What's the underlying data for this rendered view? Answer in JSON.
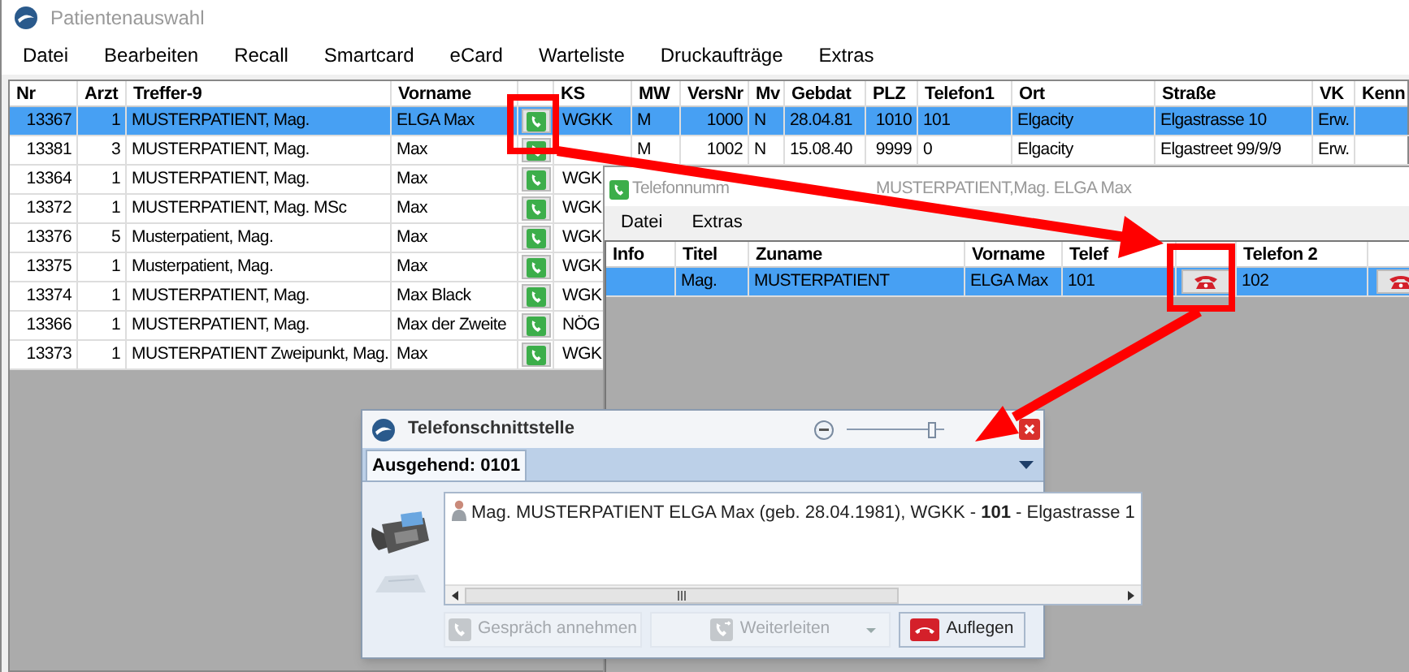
{
  "main_window": {
    "title": "Patientenauswahl",
    "menu": [
      "Datei",
      "Bearbeiten",
      "Recall",
      "Smartcard",
      "eCard",
      "Warteliste",
      "Druckaufträge",
      "Extras"
    ],
    "table": {
      "columns": [
        {
          "label": "Nr"
        },
        {
          "label": "Arzt"
        },
        {
          "label": "Treffer-9"
        },
        {
          "label": "Vorname"
        },
        {
          "kind": "greenphone"
        },
        {
          "label": "KS"
        },
        {
          "label": "MW"
        },
        {
          "label": "VersNr"
        },
        {
          "label": "Mv"
        },
        {
          "label": "Gebdat"
        },
        {
          "label": "PLZ"
        },
        {
          "label": "Telefon1"
        },
        {
          "label": "Ort"
        },
        {
          "label": "Straße"
        },
        {
          "label": "VK"
        },
        {
          "label": "Kenn"
        }
      ],
      "rows": [
        {
          "selected": true,
          "cells": [
            "13367",
            "1",
            "MUSTERPATIENT, Mag.",
            "ELGA Max",
            "",
            "WGKK",
            "M",
            "1000",
            "N",
            "28.04.81",
            "1010",
            "101",
            "Elgacity",
            "Elgastrasse 10",
            "Erw."
          ]
        },
        {
          "selected": false,
          "cells": [
            "13381",
            "3",
            "MUSTERPATIENT, Mag.",
            "Max",
            "",
            "",
            "M",
            "1002",
            "N",
            "15.08.40",
            "9999",
            "0",
            "Elgacity",
            "Elgastreet 99/9/9",
            "Erw."
          ]
        },
        {
          "selected": false,
          "cells": [
            "13364",
            "1",
            "MUSTERPATIENT, Mag.",
            "Max",
            "",
            "WGK"
          ]
        },
        {
          "selected": false,
          "cells": [
            "13372",
            "1",
            "MUSTERPATIENT, Mag. MSc",
            "Max",
            "",
            "WGK"
          ]
        },
        {
          "selected": false,
          "cells": [
            "13376",
            "5",
            "Musterpatient, Mag.",
            "Max",
            "",
            "WGK"
          ]
        },
        {
          "selected": false,
          "cells": [
            "13375",
            "1",
            "Musterpatient, Mag.",
            "Max",
            "",
            "WGK"
          ]
        },
        {
          "selected": false,
          "cells": [
            "13374",
            "1",
            "MUSTERPATIENT, Mag.",
            "Max Black",
            "",
            "WGK"
          ]
        },
        {
          "selected": false,
          "cells": [
            "13366",
            "1",
            "MUSTERPATIENT, Mag.",
            "Max der Zweite",
            "",
            "NÖG"
          ]
        },
        {
          "selected": false,
          "cells": [
            "13373",
            "1",
            "MUSTERPATIENT Zweipunkt, Mag.",
            "Max",
            "",
            "WGK"
          ]
        }
      ]
    }
  },
  "phone_window": {
    "title_parts": [
      "Telefonnumm",
      "MUSTERPATIENT,Mag. ELGA Max"
    ],
    "menu": [
      "Datei",
      "Extras"
    ],
    "table": {
      "columns": [
        {
          "label": "Info"
        },
        {
          "label": "Titel"
        },
        {
          "label": "Zuname"
        },
        {
          "label": "Vorname"
        },
        {
          "label": "Telef"
        },
        {
          "kind": "redphone"
        },
        {
          "label": "Telefon 2"
        },
        {
          "kind": "redphone"
        }
      ],
      "rows": [
        {
          "selected": true,
          "cells": [
            "",
            "Mag.",
            "MUSTERPATIENT",
            "ELGA Max",
            "101",
            "",
            "102",
            ""
          ]
        }
      ]
    }
  },
  "call_window": {
    "title": "Telefonschnittstelle",
    "zoom": {
      "level": 0.9
    },
    "tabs": [
      {
        "label": "Ausgehend: 0101",
        "selected": true
      }
    ],
    "call_info": "Mag. MUSTERPATIENT ELGA Max (geb. 28.04.1981), WGKK - **101** - Elgastrasse 1",
    "buttons": [
      {
        "kind": "answer",
        "label": "Gespräch annehmen",
        "disabled": true
      },
      {
        "kind": "forward",
        "label": "Weiterleiten",
        "disabled": true
      },
      {
        "kind": "hangup",
        "label": "Auflegen",
        "disabled": false
      }
    ]
  }
}
